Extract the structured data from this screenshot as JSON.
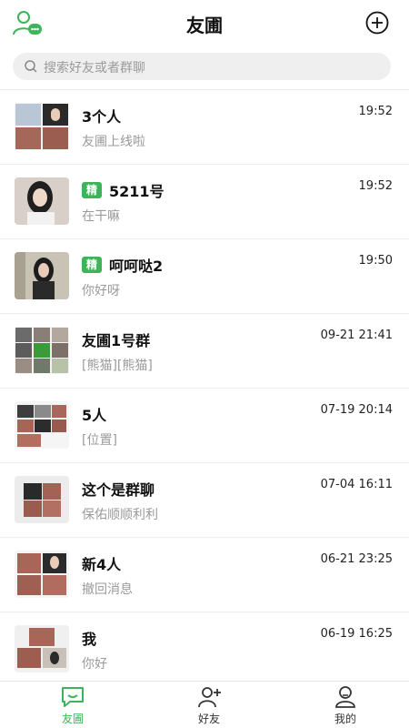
{
  "header": {
    "title": "友圃"
  },
  "search": {
    "placeholder": "搜索好友或者群聊"
  },
  "conversations": [
    {
      "name": "3个人",
      "message": "友圃上线啦",
      "time": "19:52",
      "badge": ""
    },
    {
      "name": "5211号",
      "message": "在干嘛",
      "time": "19:52",
      "badge": "精"
    },
    {
      "name": "呵呵哒2",
      "message": "你好呀",
      "time": "19:50",
      "badge": "精"
    },
    {
      "name": "友圃1号群",
      "message": "[熊猫][熊猫]",
      "time": "09-21 21:41",
      "badge": ""
    },
    {
      "name": "5人",
      "message": "[位置]",
      "time": "07-19 20:14",
      "badge": ""
    },
    {
      "name": "这个是群聊",
      "message": "保佑顺顺利利",
      "time": "07-04 16:11",
      "badge": ""
    },
    {
      "name": "新4人",
      "message": "撤回消息",
      "time": "06-21 23:25",
      "badge": ""
    },
    {
      "name": "我",
      "message": "你好",
      "time": "06-19 16:25",
      "badge": ""
    }
  ],
  "tabs": [
    {
      "label": "友圃",
      "icon": "chat-icon",
      "active": true
    },
    {
      "label": "好友",
      "icon": "add-friend-icon",
      "active": false
    },
    {
      "label": "我的",
      "icon": "profile-icon",
      "active": false
    }
  ],
  "colors": {
    "accent": "#3db35a",
    "muted": "#9a9a9a",
    "search_bg": "#efefef"
  }
}
